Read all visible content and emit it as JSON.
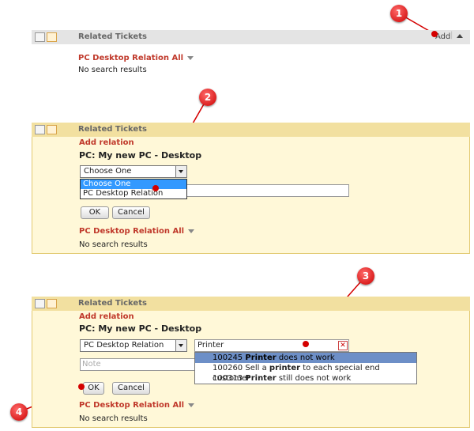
{
  "panel1": {
    "title": "Related Tickets",
    "add_label": "Add",
    "section_label": "PC Desktop Relation All",
    "no_results": "No search results"
  },
  "panel2": {
    "title": "Related Tickets",
    "add_relation": "Add relation",
    "object_title": "PC: My new PC - Desktop",
    "select_value": "Choose One",
    "dropdown_options": [
      "Choose One",
      "PC Desktop Relation"
    ],
    "ok_label": "OK",
    "cancel_label": "Cancel",
    "section_label": "PC Desktop Relation All",
    "no_results": "No search results"
  },
  "panel3": {
    "title": "Related Tickets",
    "add_relation": "Add relation",
    "object_title": "PC: My new PC - Desktop",
    "select_value": "PC Desktop Relation",
    "search_value": "Printer",
    "note_placeholder": "Note",
    "suggestions": [
      {
        "id": "100245",
        "pre": "",
        "bold": "Printer",
        "post": " does not work"
      },
      {
        "id": "100260",
        "pre": "Sell a ",
        "bold": "printer",
        "post": " to each special end customer"
      },
      {
        "id": "100313",
        "pre": "",
        "bold": "Printer",
        "post": " still does not work"
      }
    ],
    "ok_label": "OK",
    "cancel_label": "Cancel",
    "section_label": "PC Desktop Relation All",
    "no_results": "No search results"
  },
  "markers": [
    "1",
    "2",
    "3",
    "4"
  ]
}
